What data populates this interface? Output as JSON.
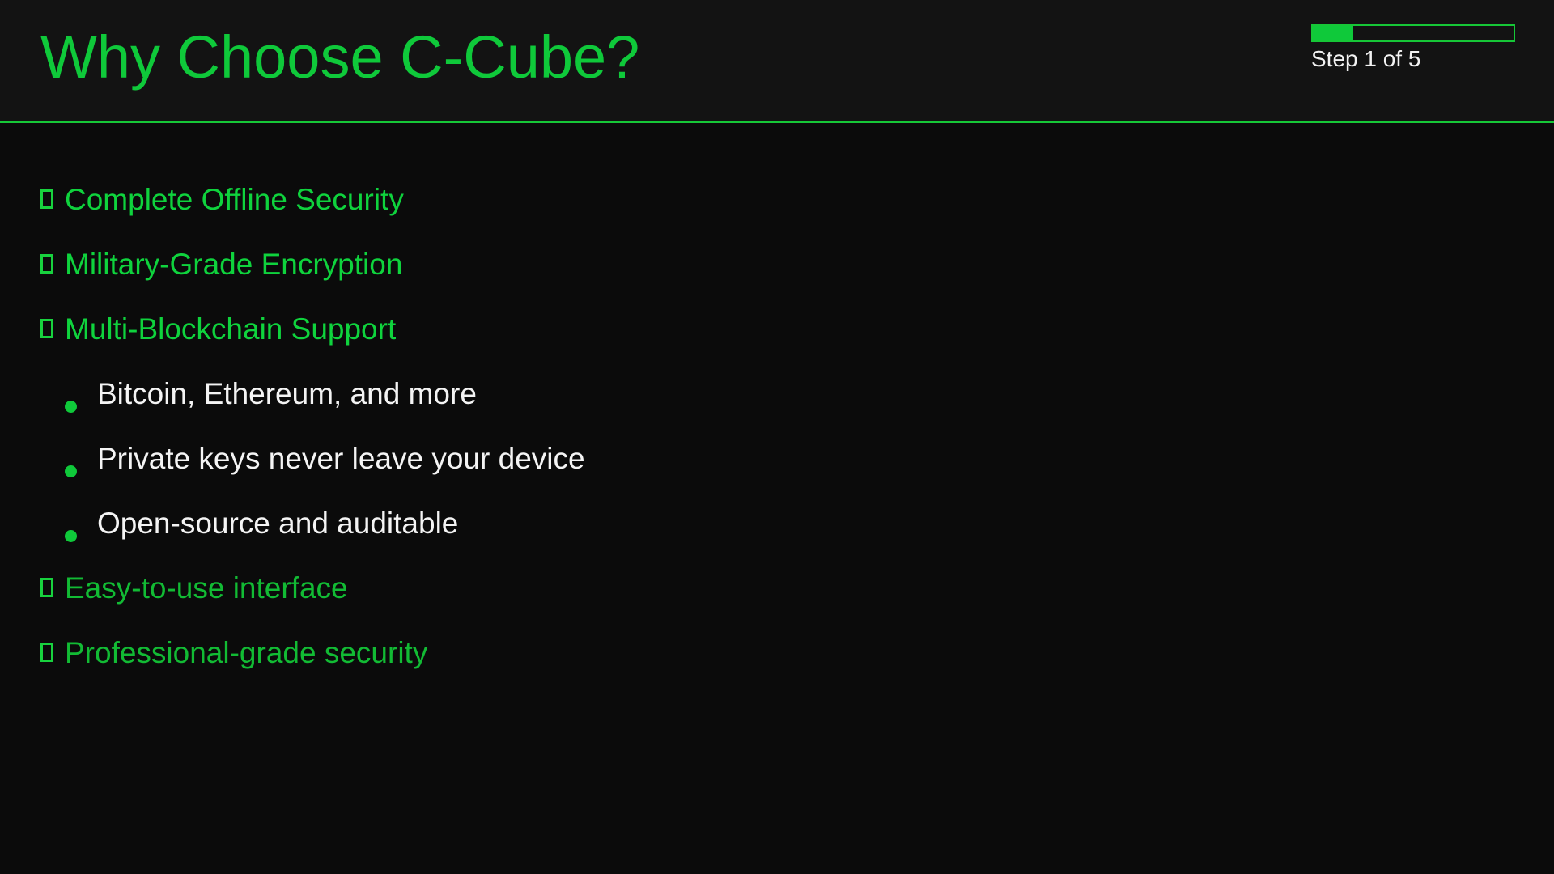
{
  "header": {
    "title": "Why Choose C-Cube?",
    "step_label": "Step 1 of 5",
    "progress": {
      "current_step": 1,
      "total_steps": 5,
      "fraction": 0.2
    }
  },
  "features": [
    {
      "label": "Complete Offline Security",
      "icon": "checkbox-icon"
    },
    {
      "label": "Military-Grade Encryption",
      "icon": "checkbox-icon"
    },
    {
      "label": "Multi-Blockchain Support",
      "icon": "checkbox-icon"
    },
    {
      "label": "Easy-to-use interface",
      "icon": "checkbox-icon"
    },
    {
      "label": "Professional-grade security",
      "icon": "checkbox-icon"
    }
  ],
  "sub_points": [
    {
      "label": "Bitcoin, Ethereum, and more",
      "icon": "bullet-dot-icon"
    },
    {
      "label": "Private keys never leave your device",
      "icon": "bullet-dot-icon"
    },
    {
      "label": "Open-source and auditable",
      "icon": "bullet-dot-icon"
    }
  ],
  "colors": {
    "accent": "#0fc93a",
    "background": "#0b0b0b",
    "header_background": "#131313",
    "text": "#f4f4f4"
  }
}
